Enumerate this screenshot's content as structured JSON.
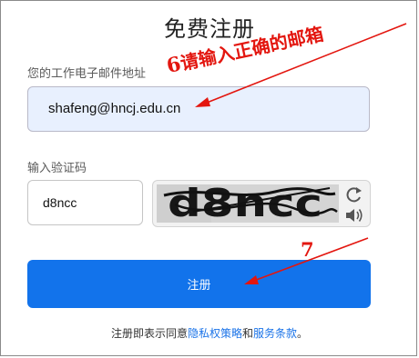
{
  "page": {
    "title": "免费注册"
  },
  "email": {
    "label": "您的工作电子邮件地址",
    "value": "shafeng@hncj.edu.cn"
  },
  "verification": {
    "label": "输入验证码",
    "value": "d8ncc",
    "captcha_text": "d8ncc"
  },
  "captcha_tools": {
    "refresh_icon": "refresh-icon",
    "audio_icon": "speaker-icon"
  },
  "register_button": {
    "label": "注册"
  },
  "terms": {
    "prefix": "注册即表示同意",
    "privacy_link": "隐私权策略",
    "conjunction": "和",
    "service_link": "服务条款",
    "suffix": "。"
  },
  "annotations": {
    "step6_number": "6",
    "step6_text": "请输入正确的邮箱",
    "step7_number": "7"
  },
  "colors": {
    "primary_button": "#1273eb",
    "link": "#1a73e8",
    "email_field_bg": "#e8f0fe",
    "annotation": "#e3160f"
  }
}
